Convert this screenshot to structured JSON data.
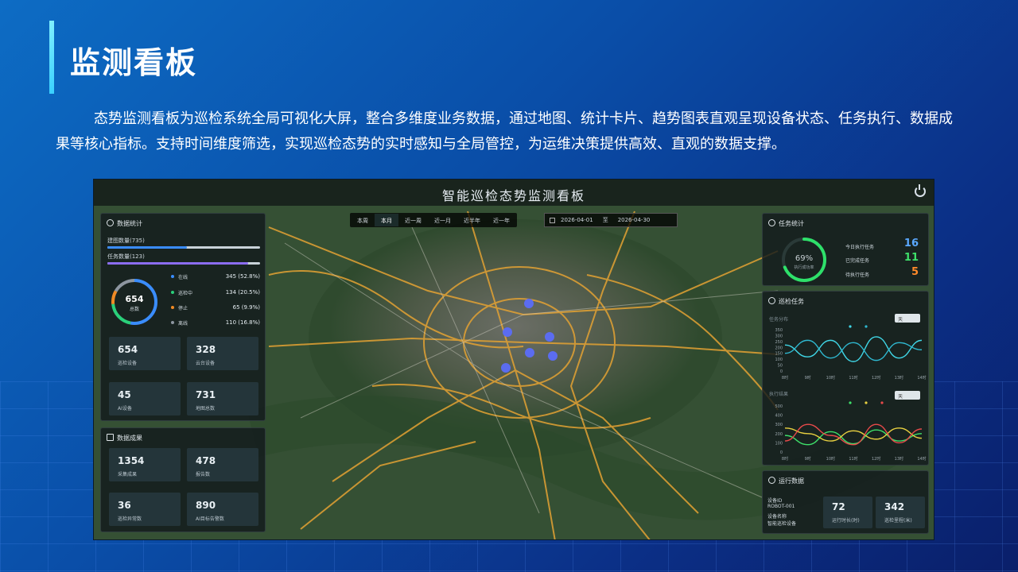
{
  "slide": {
    "title": "监测看板",
    "description": "态势监测看板为巡检系统全局可视化大屏，整合多维度业务数据，通过地图、统计卡片、趋势图表直观呈现设备状态、任务执行、数据成果等核心指标。支持时间维度筛选，实现巡检态势的实时感知与全局管控，为运维决策提供高效、直观的数据支撑。"
  },
  "dashboard": {
    "title": "智能巡检态势监测看板",
    "filters": [
      "本周",
      "本月",
      "近一周",
      "近一月",
      "近半年",
      "近一年"
    ],
    "active_filter": "本月",
    "date_start": "2026-04-01",
    "date_sep": "至",
    "date_end": "2026-04-30"
  },
  "left": {
    "stats_title": "数据统计",
    "bar1_label": "建图数量(735)",
    "bar2_label": "任务数量(123)",
    "bar1_ratio": 0.52,
    "bar2_ratio": 0.92,
    "donut_value": "654",
    "donut_label": "总数",
    "legend": [
      {
        "label": "在线",
        "value": "345 (52.8%)",
        "color": "#3a8dff"
      },
      {
        "label": "巡检中",
        "value": "134 (20.5%)",
        "color": "#2ad07a"
      },
      {
        "label": "停止",
        "value": "65 (9.9%)",
        "color": "#f08a24"
      },
      {
        "label": "离线",
        "value": "110 (16.8%)",
        "color": "#8d96a0"
      }
    ],
    "cards": [
      {
        "value": "654",
        "label": "巡检设备"
      },
      {
        "value": "328",
        "label": "云台设备"
      },
      {
        "value": "45",
        "label": "AI设备"
      },
      {
        "value": "731",
        "label": "地图总数"
      }
    ],
    "results_title": "数据成果",
    "results": [
      {
        "value": "1354",
        "label": "采集成果"
      },
      {
        "value": "478",
        "label": "报告数"
      },
      {
        "value": "36",
        "label": "巡检异常数"
      },
      {
        "value": "890",
        "label": "AI目标告警数"
      }
    ]
  },
  "right": {
    "task_title": "任务统计",
    "gauge_value": "69%",
    "gauge_label": "执行成功率",
    "gauge_ratio": 0.69,
    "task_rows": [
      {
        "label": "今日执行任务",
        "value": "16",
        "color": "#5aa8ff"
      },
      {
        "label": "已完成任务",
        "value": "11",
        "color": "#3ee06a"
      },
      {
        "label": "待执行任务",
        "value": "5",
        "color": "#ff8a2a"
      }
    ],
    "inspect_title": "巡检任务",
    "chart1_label": "任务分布",
    "chart2_label": "执行结果",
    "select_label": "天",
    "run_title": "运行数据",
    "device_id_label": "设备ID",
    "device_id": "ROBOT-001",
    "device_name_label": "设备名称",
    "device_name": "智能巡检设备",
    "run_cards": [
      {
        "value": "72",
        "label": "运行时长(时)"
      },
      {
        "value": "342",
        "label": "巡检里程(米)"
      }
    ]
  },
  "chart_data": [
    {
      "type": "line",
      "title": "任务分布",
      "x": [
        "8时",
        "9时",
        "10时",
        "11时",
        "12时",
        "13时",
        "14时"
      ],
      "ylim": [
        0,
        350
      ],
      "yticks": [
        "350",
        "300",
        "250",
        "200",
        "150",
        "100",
        "50",
        "0"
      ],
      "series": [
        {
          "color": "#40d8e8",
          "values": [
            220,
            120,
            260,
            80,
            290,
            110,
            260
          ]
        },
        {
          "color": "#2fb8d0",
          "values": [
            150,
            260,
            110,
            240,
            90,
            240,
            180
          ]
        }
      ]
    },
    {
      "type": "line",
      "title": "执行结果",
      "x": [
        "8时",
        "9时",
        "10时",
        "11时",
        "12时",
        "13时",
        "14时"
      ],
      "ylim": [
        0,
        500
      ],
      "yticks": [
        "500",
        "400",
        "300",
        "200",
        "100",
        "0"
      ],
      "series": [
        {
          "color": "#3ee06a",
          "values": [
            180,
            80,
            220,
            90,
            240,
            120,
            200
          ]
        },
        {
          "color": "#e8d040",
          "values": [
            260,
            200,
            120,
            230,
            140,
            260,
            150
          ]
        },
        {
          "color": "#e84a4a",
          "values": [
            120,
            300,
            180,
            80,
            300,
            100,
            250
          ]
        }
      ]
    }
  ]
}
